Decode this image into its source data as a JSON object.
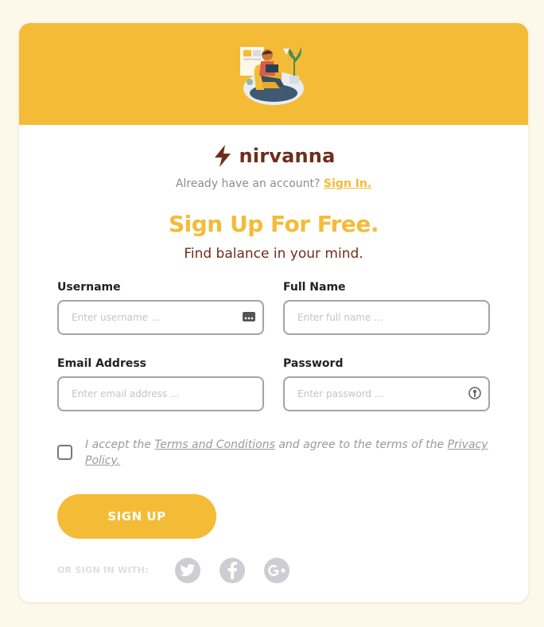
{
  "brand": {
    "name": "nirvanna",
    "icon": "lightning-bolt-icon",
    "color": "#6f2c1a"
  },
  "account": {
    "prompt": "Already have an account?",
    "signin_link": "Sign In."
  },
  "headline": "Sign Up For Free.",
  "subheadline": "Find balance in your mind.",
  "form": {
    "username": {
      "label": "Username",
      "placeholder": "Enter username ...",
      "value": ""
    },
    "full_name": {
      "label": "Full Name",
      "placeholder": "Enter full name ...",
      "value": ""
    },
    "email": {
      "label": "Email Address",
      "placeholder": "Enter email address ...",
      "value": ""
    },
    "password": {
      "label": "Password",
      "placeholder": "Enter password ...",
      "value": ""
    }
  },
  "terms": {
    "checked": false,
    "text_before": "I accept the ",
    "terms_link": "Terms and Conditions",
    "text_middle": " and agree to the terms of the ",
    "privacy_link": "Privacy Policy."
  },
  "signup_button": "SIGN UP",
  "social": {
    "label": "OR SIGN IN WITH:",
    "providers": [
      "twitter-icon",
      "facebook-icon",
      "google-plus-icon"
    ]
  },
  "colors": {
    "accent": "#f4bb37",
    "brand_text": "#6f2c1a",
    "background": "#fdf9ea",
    "social_icon_bg": "#cdcdd3"
  }
}
